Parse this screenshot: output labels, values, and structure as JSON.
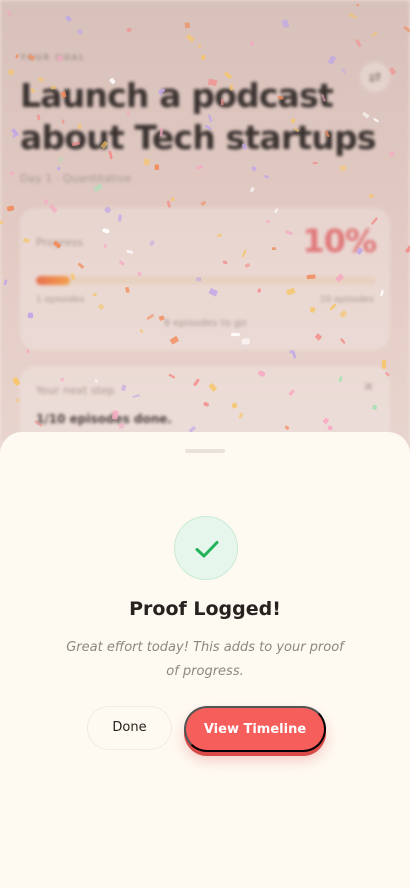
{
  "background": {
    "eyebrow": "YOUR GOAL",
    "title": "Launch a podcast about Tech startups",
    "meta": "Day 1 · Quantitative",
    "progress_card": {
      "label": "Progress",
      "percent_text": "10%",
      "progress": 0.1,
      "start_label": "1 episodes",
      "end_label": "10 episodes",
      "remaining_text": "9 episodes to go"
    },
    "next_card": {
      "label": "Your next step",
      "close_glyph": "✕",
      "text": "1/10 episodes done."
    }
  },
  "sheet": {
    "title": "Proof Logged!",
    "subtitle": "Great effort today! This adds to your proof of progress.",
    "done_label": "Done",
    "timeline_label": "View Timeline"
  },
  "colors": {
    "accent": "#f65e5c",
    "success": "#22b35a",
    "sheet_bg": "#fefaf2"
  }
}
